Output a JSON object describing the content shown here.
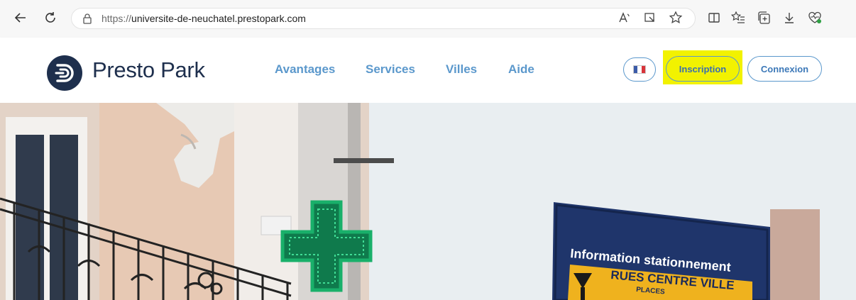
{
  "browser": {
    "url_protocol": "https://",
    "url_host": "universite-de-neuchatel.prestopark.com"
  },
  "header": {
    "logo_text": "Presto Park",
    "nav": [
      "Avantages",
      "Services",
      "Villes",
      "Aide"
    ],
    "signup_label": "Inscription",
    "login_label": "Connexion",
    "highlight_color": "#f2f200"
  },
  "hero": {
    "sign_title": "Information stationnement",
    "sign_subtitle": "RUES CENTRE VILLE",
    "sign_line": "PLACES"
  }
}
